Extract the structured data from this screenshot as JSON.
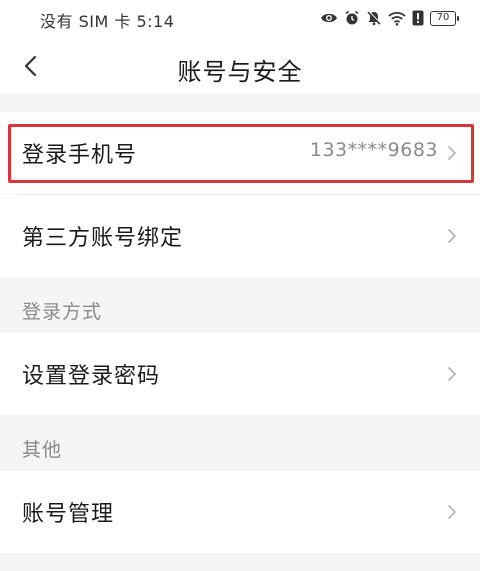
{
  "status_bar": {
    "text": "没有 SIM 卡 5:14",
    "battery": "70",
    "icons": [
      "eye-icon",
      "alarm-icon",
      "bell-off-icon",
      "wifi-icon",
      "alert-icon",
      "battery-icon"
    ]
  },
  "nav": {
    "title": "账号与安全",
    "back_icon": "chevron-left-icon"
  },
  "rows": {
    "phone": {
      "label": "登录手机号",
      "value": "133****9683"
    },
    "third_party": {
      "label": "第三方账号绑定"
    },
    "password": {
      "label": "设置登录密码"
    },
    "account_manage": {
      "label": "账号管理"
    }
  },
  "sections": {
    "login_method": "登录方式",
    "other": "其他"
  },
  "colors": {
    "page_background": "#f4f5f7",
    "card_background": "#ffffff",
    "highlight": "#d9343a",
    "secondary_text": "#8a8a8a"
  }
}
